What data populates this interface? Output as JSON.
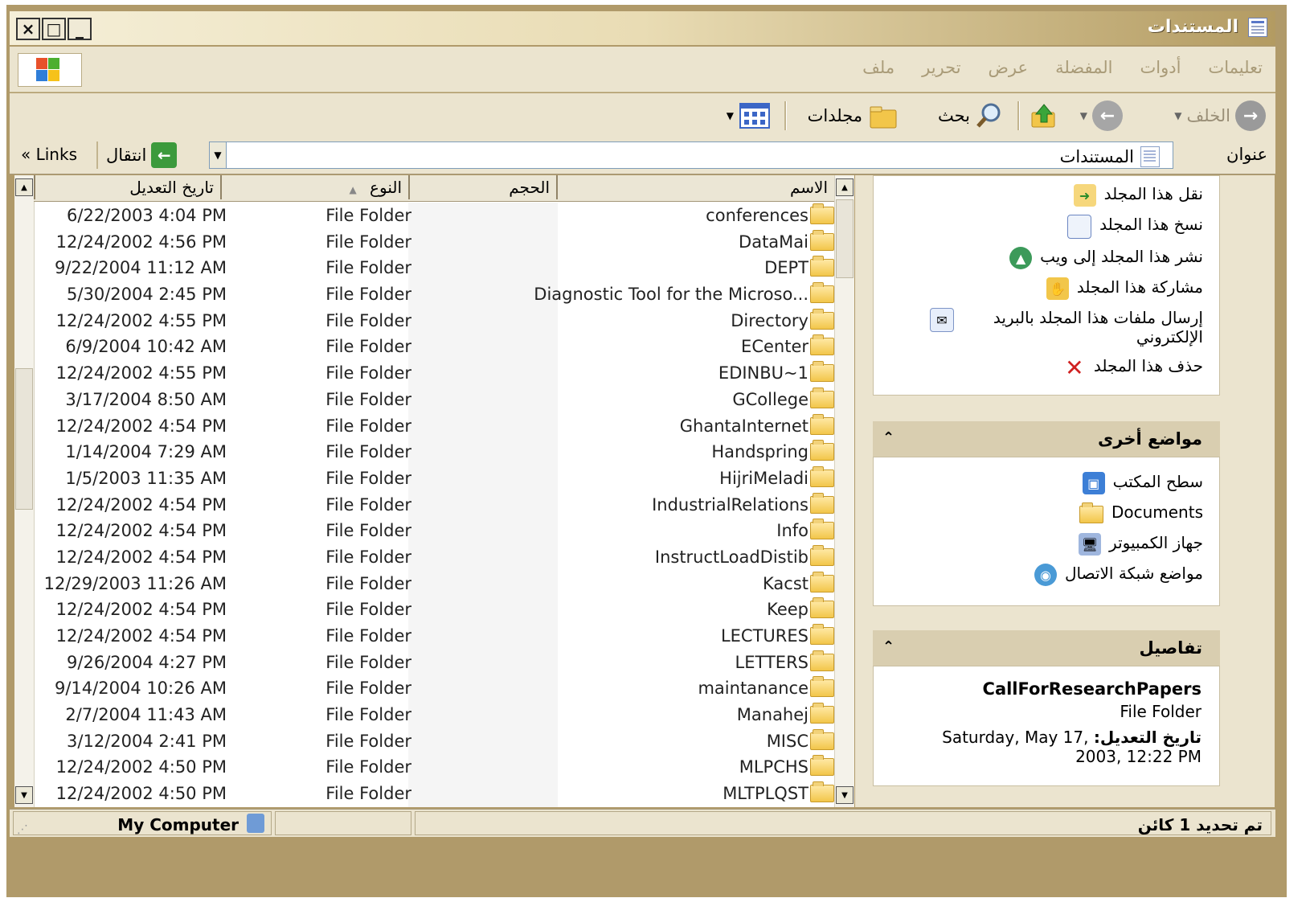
{
  "window": {
    "title": "المستندات",
    "min_glyph": "_",
    "max_glyph": "□",
    "close_glyph": "×"
  },
  "menubar": {
    "items": [
      "ملف",
      "تحرير",
      "عرض",
      "المفضلة",
      "أدوات",
      "تعليمات"
    ]
  },
  "toolbar": {
    "back_label": "الخلف",
    "search_label": "بحث",
    "folders_label": "مجلدات"
  },
  "address": {
    "label": "عنوان",
    "value": "المستندات",
    "go_label": "انتقال",
    "links_label": "Links"
  },
  "columns": {
    "name": "الاسم",
    "size": "الحجم",
    "type": "النوع",
    "modified": "تاريخ التعديل"
  },
  "files": [
    {
      "name": "conferences",
      "type": "File Folder",
      "modified": "6/22/2003 4:04 PM"
    },
    {
      "name": "DataMai",
      "type": "File Folder",
      "modified": "12/24/2002 4:56 PM"
    },
    {
      "name": "DEPT",
      "type": "File Folder",
      "modified": "9/22/2004 11:12 AM"
    },
    {
      "name": "Diagnostic Tool for the Microso...",
      "type": "File Folder",
      "modified": "5/30/2004 2:45 PM"
    },
    {
      "name": "Directory",
      "type": "File Folder",
      "modified": "12/24/2002 4:55 PM"
    },
    {
      "name": "ECenter",
      "type": "File Folder",
      "modified": "6/9/2004 10:42 AM"
    },
    {
      "name": "EDINBU~1",
      "type": "File Folder",
      "modified": "12/24/2002 4:55 PM"
    },
    {
      "name": "GCollege",
      "type": "File Folder",
      "modified": "3/17/2004 8:50 AM"
    },
    {
      "name": "GhantaInternet",
      "type": "File Folder",
      "modified": "12/24/2002 4:54 PM"
    },
    {
      "name": "Handspring",
      "type": "File Folder",
      "modified": "1/14/2004 7:29 AM"
    },
    {
      "name": "HijriMeladi",
      "type": "File Folder",
      "modified": "1/5/2003 11:35 AM"
    },
    {
      "name": "IndustrialRelations",
      "type": "File Folder",
      "modified": "12/24/2002 4:54 PM"
    },
    {
      "name": "Info",
      "type": "File Folder",
      "modified": "12/24/2002 4:54 PM"
    },
    {
      "name": "InstructLoadDistib",
      "type": "File Folder",
      "modified": "12/24/2002 4:54 PM"
    },
    {
      "name": "Kacst",
      "type": "File Folder",
      "modified": "12/29/2003 11:26 AM"
    },
    {
      "name": "Keep",
      "type": "File Folder",
      "modified": "12/24/2002 4:54 PM"
    },
    {
      "name": "LECTURES",
      "type": "File Folder",
      "modified": "12/24/2002 4:54 PM"
    },
    {
      "name": "LETTERS",
      "type": "File Folder",
      "modified": "9/26/2004 4:27 PM"
    },
    {
      "name": "maintanance",
      "type": "File Folder",
      "modified": "9/14/2004 10:26 AM"
    },
    {
      "name": "Manahej",
      "type": "File Folder",
      "modified": "2/7/2004 11:43 AM"
    },
    {
      "name": "MISC",
      "type": "File Folder",
      "modified": "3/12/2004 2:41 PM"
    },
    {
      "name": "MLPCHS",
      "type": "File Folder",
      "modified": "12/24/2002 4:50 PM"
    },
    {
      "name": "MLTPLQST",
      "type": "File Folder",
      "modified": "12/24/2002 4:50 PM"
    }
  ],
  "tasks": {
    "folder_tasks": [
      {
        "label": "نقل هذا المجلد",
        "icon": "move-folder-icon"
      },
      {
        "label": "نسخ هذا المجلد",
        "icon": "copy-folder-icon"
      },
      {
        "label": "نشر هذا المجلد إلى ويب",
        "icon": "publish-web-icon"
      },
      {
        "label": "مشاركة هذا المجلد",
        "icon": "share-folder-icon"
      },
      {
        "label": "إرسال ملفات هذا المجلد بالبريد الإلكتروني",
        "icon": "email-icon"
      },
      {
        "label": "حذف هذا المجلد",
        "icon": "delete-icon"
      }
    ],
    "other_places_title": "مواضع أخرى",
    "other_places": [
      {
        "label": "سطح المكتب",
        "icon": "desktop-icon"
      },
      {
        "label": "Documents",
        "icon": "folder-icon"
      },
      {
        "label": "جهاز الكمبيوتر",
        "icon": "computer-icon"
      },
      {
        "label": "مواضع شبكة الاتصال",
        "icon": "network-icon"
      }
    ],
    "details_title": "تفاصيل",
    "details": {
      "name": "CallForResearchPapers",
      "type": "File Folder",
      "modified_label": "تاريخ التعديل:",
      "modified_value": "Saturday, May 17, 2003, 12:22 PM"
    }
  },
  "status": {
    "selection": "تم تحديد 1 كائن",
    "location": "My Computer"
  },
  "colors": {
    "frame": "#b09a6a",
    "chrome": "#ebe4cf",
    "panel_head": "#d9ceb0"
  }
}
